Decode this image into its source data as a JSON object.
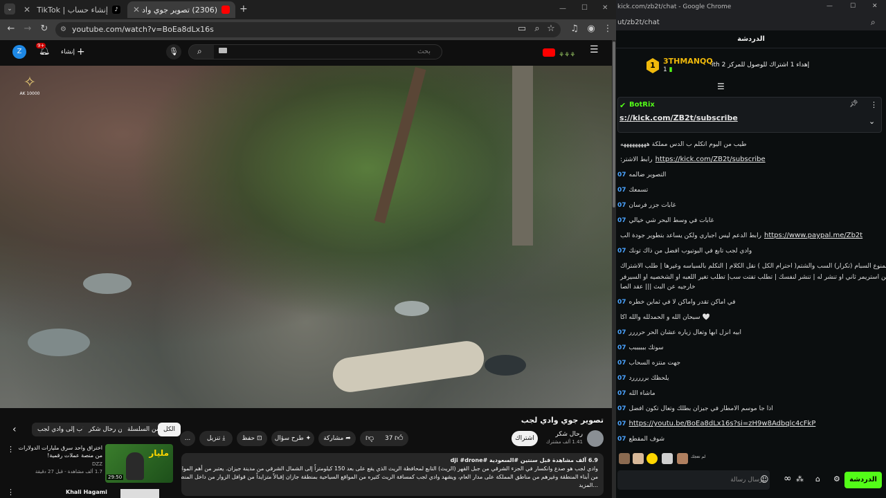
{
  "browser_left": {
    "tabs": [
      {
        "label": "إنشاء حساب | TikTok",
        "favicon_color": "#000000"
      },
      {
        "label": "(2306) تصوير جوي وادي لجب",
        "favicon_color": "#ff0000"
      }
    ],
    "url": "youtube.com/watch?v=BoEa8dLx16s",
    "window_controls": [
      "—",
      "☐",
      "✕"
    ]
  },
  "youtube_header": {
    "avatar_letter": "Z",
    "notif_badge": "9+",
    "create_label": "إنشاء",
    "search_placeholder": "بحث"
  },
  "video": {
    "watermark_text": "AK 10000",
    "title": "تصوير جوي وادي لجب",
    "channel": "رحال شكر",
    "subscribers": "1.41 ألف مشترك",
    "subscribe_label": "اشتراك",
    "likes": "37",
    "share_label": "مشاركة",
    "ask_label": "طرح سؤال",
    "save_label": "حفظ",
    "download_label": "تنزيل",
    "more_label": "..."
  },
  "chips": [
    "الكل",
    "من السلسلة",
    "من رحال شكر",
    "الذهاب إلى وادي لجب"
  ],
  "description": {
    "meta": "6.9 آلف مشاهدة  قبل سنتين  #السعودية #dji #drone",
    "line1": "وادي لجب هو صدع وانكسار في الجزء الشرقي من جبل القهر (الريث) التابع لمحافظة الريث الذي يقع على بعد 150 كيلومتراً إلى الشمال الشرقي من مدينة جيزان. يعتبر من أهم المواقع السياحية وأبرزها ومزاراً يؤمه الزائرون",
    "line2": "من أبناء المنطقة وغيرهم من مناطق المملكة على مدار العام، ويشهد وادي لجب كمسافة الريث كثيره من المواقع السياحية بمنطقة جازان إقبالاً متزايداً من قوافل الزوار من داخل المنطقة وخارجها",
    "more": "...المزيد"
  },
  "sidebar_video": {
    "title": "اختراق واحد سرق مليارات الدولارات من منصة عملات رقمية!",
    "channel": "DZZ",
    "meta": "1.7 ألف مشاهدة - قبل 27 دقيقة",
    "duration": "29:50",
    "thumb_text": "مليار",
    "next_channel": "Khali Hagami"
  },
  "browser_right": {
    "window_title": "kick.com/zb2t/chat - Google Chrome",
    "url": "ut/zb2t/chat"
  },
  "chat": {
    "header": "الدردشة",
    "gift_user": "3THMANQQ",
    "gift_rank": "1",
    "gift_count": "1",
    "gift_text": "إهداء 1 اشتراك للوصول للمركز 2 ith",
    "bot_name": "BotRix",
    "pinned_link": "s://kick.com/ZB2t/subscribe",
    "messages": [
      {
        "user": "",
        "text": "طيب من اليوم اتكلم ب الدس مملكة هههههههههه",
        "link": ""
      },
      {
        "user": "",
        "text": ":رابط الاشتر",
        "link": "https://kick.com/ZB2t/subscribe"
      },
      {
        "user": "07",
        "text": "التصوير ضالمه",
        "link": ""
      },
      {
        "user": "07",
        "text": "تسمعك",
        "link": ""
      },
      {
        "user": "07",
        "text": "غابات جزر فرسان",
        "link": ""
      },
      {
        "user": "07",
        "text": "غابات في وسط البحر شي خيالي",
        "link": ""
      },
      {
        "user": "",
        "text": "رابط الدعم ليس اجباري ولكن يساعد بتطوير جودة الب",
        "link": "https://www.paypal.me/Zb2t"
      },
      {
        "user": "07",
        "text": "وادي لجب تابع في اليوتيوب افضل من ذاك تونك",
        "link": ""
      },
      {
        "user": "",
        "text": "القوانين: ممنوع السبام (تكرار) السب والشتم( احترام الكل ) نقل الكلام | التكلم بالسياسه وغيرها | طلب الاشتراك",
        "link": ""
      },
      {
        "user": "",
        "text": "تسال عن استريمر ثاني او تنشر له | تنشر لنفسك | تطلب تفتت سب| تطلب تغير اللعبه او الشخصيه او السيرفر |",
        "link": ""
      },
      {
        "user": "",
        "text": "خارجيه عن البث ||| عقد الصا",
        "link": ""
      },
      {
        "user": "07",
        "text": "في اماكن تقدر واماكن لا في ثماين خطره",
        "link": ""
      },
      {
        "user": "",
        "text": "سبحان الله و الحمدلله والله اكا 🤍",
        "link": ""
      },
      {
        "user": "07",
        "text": "ابيه انزل ابها وتعال زياره عشان الحر حرررر",
        "link": ""
      },
      {
        "user": "07",
        "text": "سوتك ببببببب",
        "link": ""
      },
      {
        "user": "07",
        "text": "جهت منتزه السحاب",
        "link": ""
      },
      {
        "user": "07",
        "text": "يلحظك برررررد",
        "link": ""
      },
      {
        "user": "07",
        "text": "ماشاء الله",
        "link": ""
      },
      {
        "user": "07",
        "text": "اذا جا موسم الامطار في جيزان بطلك وتعال تكون افضل",
        "link": ""
      },
      {
        "user": "07",
        "text": "",
        "link": "https://youtu.be/BoEa8dLx16s?si=zH9w8Adbqlc4cFkP"
      },
      {
        "user": "07",
        "text": "شوف المقطع",
        "link": ""
      }
    ],
    "emote_label": "لم تعجك",
    "input_placeholder": "إرسال رسالة",
    "send_label": "الدردشة",
    "accent": "#53fc18"
  }
}
